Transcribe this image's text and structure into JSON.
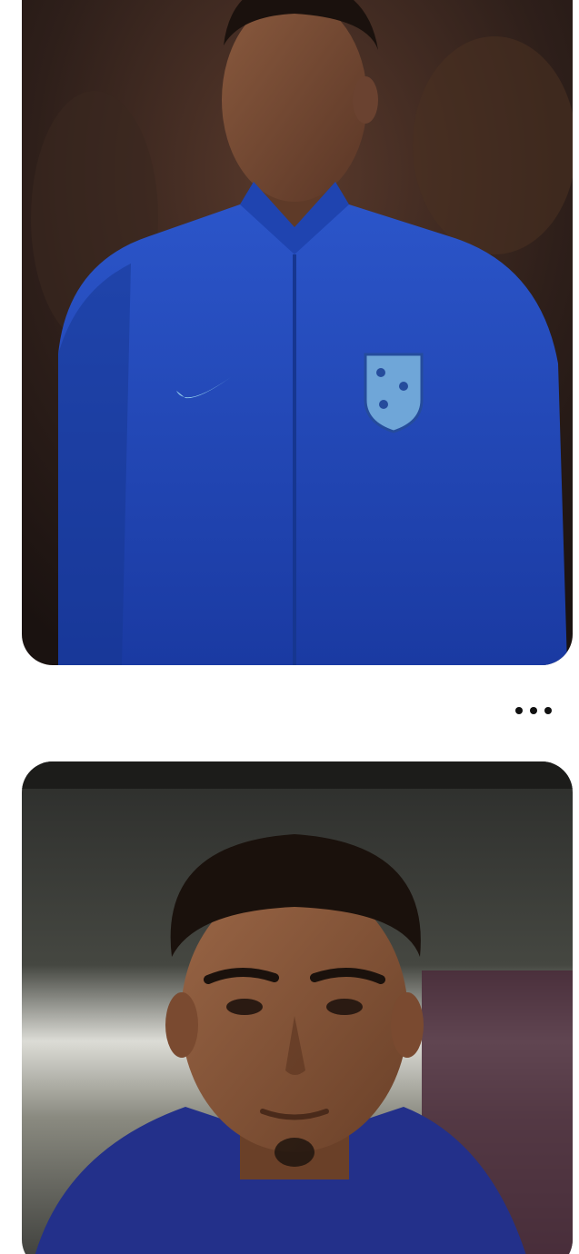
{
  "feed": {
    "posts": [
      {
        "image_icon": "player-portrait-photo",
        "jacket_color": "#1d47b8"
      },
      {
        "image_icon": "player-headshot-photo",
        "jacket_color": "#23308a"
      }
    ],
    "more_icon": "more-horizontal-icon"
  },
  "colors": {
    "background": "#ffffff",
    "dots": "#111111"
  }
}
